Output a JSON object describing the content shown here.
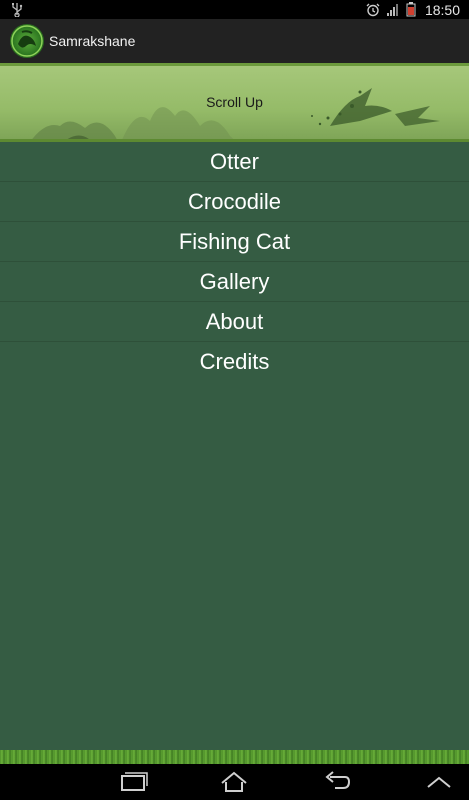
{
  "status_bar": {
    "time": "18:50",
    "icons": [
      "usb-icon",
      "alarm-icon",
      "signal-icon",
      "battery-icon"
    ]
  },
  "action_bar": {
    "title": "Samrakshane",
    "icon": "app-logo-icon"
  },
  "banner": {
    "label": "Scroll Up"
  },
  "menu": {
    "items": [
      {
        "label": "Otter"
      },
      {
        "label": "Crocodile"
      },
      {
        "label": "Fishing Cat"
      },
      {
        "label": "Gallery"
      },
      {
        "label": "About"
      },
      {
        "label": "Credits"
      }
    ]
  },
  "nav_bar": {
    "icons": [
      "recent-apps-icon",
      "home-icon",
      "back-icon",
      "menu-up-icon"
    ]
  },
  "colors": {
    "background": "#355c43",
    "action_bar": "#222222",
    "banner": "#95bb68"
  }
}
